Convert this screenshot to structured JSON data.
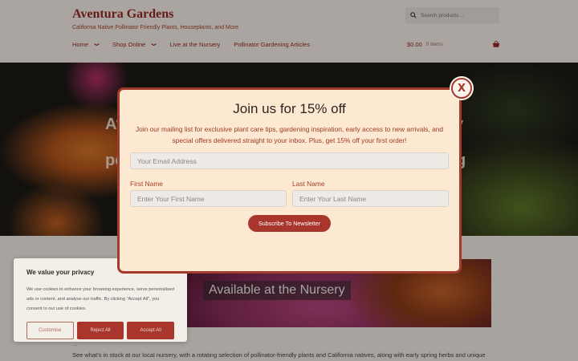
{
  "site": {
    "title": "Aventura Gardens",
    "tagline": "California Native Pollinator Friendly Plants, Houseplants, and More",
    "search_placeholder": "Search products…"
  },
  "nav": {
    "items": [
      {
        "label": "Home",
        "chevron": true
      },
      {
        "label": "Shop Online",
        "chevron": true
      },
      {
        "label": "Live at the Nursery",
        "chevron": false
      },
      {
        "label": "Pollinator Gardening Articles",
        "chevron": false
      }
    ],
    "chevron_glyph": "❯"
  },
  "cart": {
    "amount": "$0.00",
    "count": "0 items"
  },
  "hero": {
    "line1": "Av",
    "line1_right": "y",
    "line2": "po",
    "line2_right": "g"
  },
  "section": {
    "caption": "Available at the Nursery"
  },
  "body": {
    "faded_line": "…",
    "text": "See what's in stock at our local nursery, with a rotating selection of pollinator-friendly plants and California natives, along with early spring herbs and unique"
  },
  "cookie": {
    "title": "We value your privacy",
    "text": "We use cookies to enhance your browsing experience, serve personalised ads or content, and analyse our traffic. By clicking \"Accept All\", you consent to our use of cookies.",
    "customise": "Customise",
    "reject": "Reject All",
    "accept": "Accept All"
  },
  "modal": {
    "close": "X",
    "title": "Join us for 15% off",
    "description": "Join our mailing list for exclusive plant care tips, gardening inspiration, early access to new arrivals, and special offers delivered straight to your inbox. Plus, get 15% off your first order!",
    "email_placeholder": "Your Email Address",
    "first_name_label": "First Name",
    "first_name_placeholder": "Enter Your First Name",
    "last_name_label": "Last Name",
    "last_name_placeholder": "Enter Your Last Name",
    "subscribe": "Subscribe To Newsletter"
  },
  "colors": {
    "accent": "#a33b2d",
    "modal_bg": "#fde9d2",
    "brand": "#9a2a24"
  }
}
